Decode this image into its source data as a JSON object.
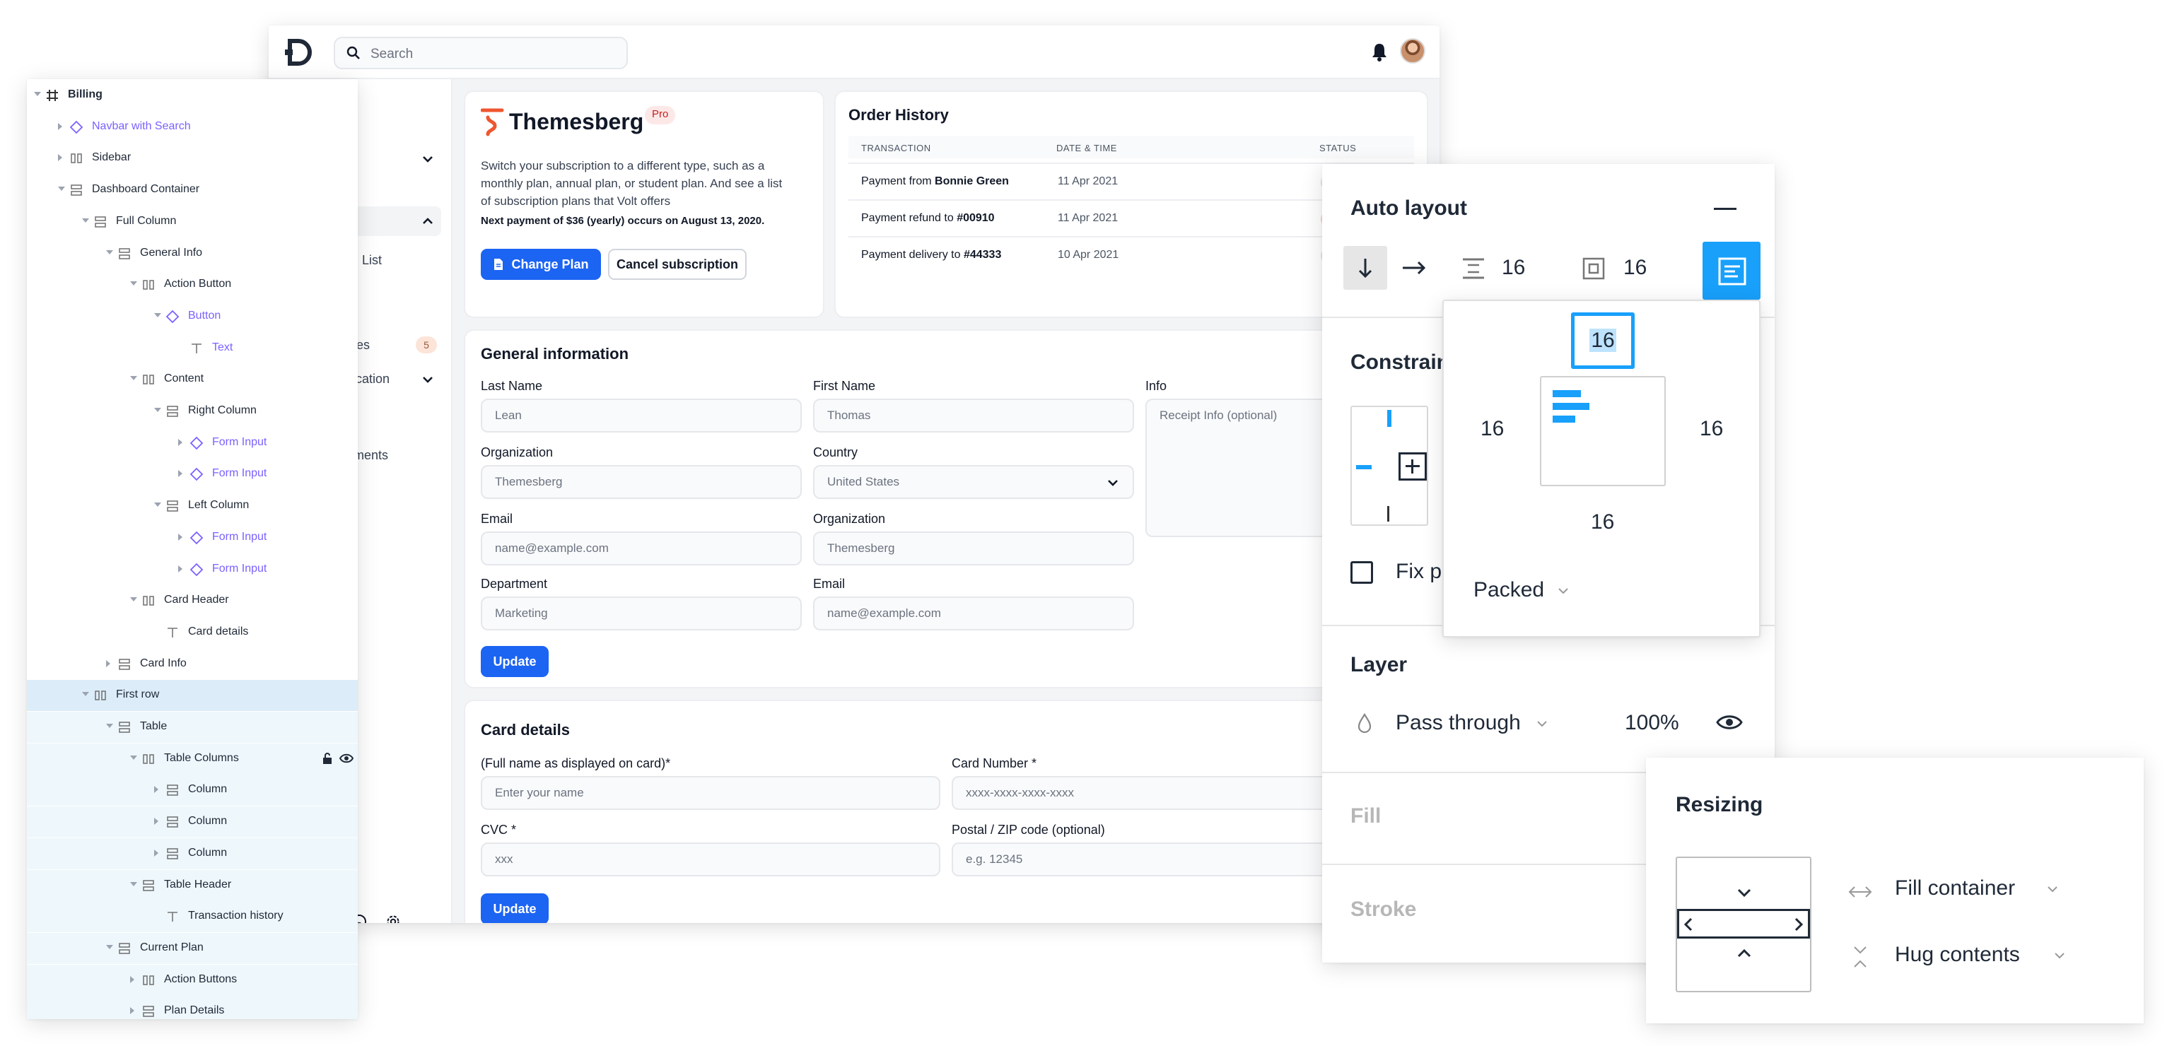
{
  "app": {
    "search_placeholder": "Search",
    "sidebar": {
      "fragments": [
        "w",
        "List",
        "es",
        "tication",
        "ments"
      ],
      "badge": "5"
    },
    "plan": {
      "brand": "Themesberg",
      "badge": "Pro",
      "desc_lines": [
        "Switch your subscription to a different type, such as a",
        "monthly plan, annual plan, or student plan. And see a list",
        "of subscription plans that Volt offers"
      ],
      "next_payment": "Next payment of $36 (yearly) occurs on August 13, 2020.",
      "change_plan": "Change Plan",
      "cancel": "Cancel subscription"
    },
    "orders": {
      "title": "Order History",
      "headers": [
        "TRANSACTION",
        "DATE & TIME",
        "STATUS"
      ],
      "rows": [
        {
          "prefix": "Payment from ",
          "bold": "Bonnie Green",
          "date": "11 Apr 2021",
          "status_color": "#e5e7eb"
        },
        {
          "prefix": "Payment refund to ",
          "bold": "#00910",
          "date": "11 Apr 2021",
          "status_color": "#f6d5c8"
        },
        {
          "prefix": "Payment delivery to ",
          "bold": "#44333",
          "date": "10 Apr 2021",
          "status_color": "#e1e4fb"
        }
      ]
    },
    "general": {
      "title": "General information",
      "last_name_label": "Last Name",
      "last_name": "Lean",
      "first_name_label": "First Name",
      "first_name": "Thomas",
      "info_label": "Info",
      "info_placeholder": "Receipt Info (optional)",
      "org_label": "Organization",
      "org": "Themesberg",
      "country_label": "Country",
      "country": "United States",
      "email_label": "Email",
      "email": "name@example.com",
      "org2_label": "Organization",
      "org2": "Themesberg",
      "dept_label": "Department",
      "dept": "Marketing",
      "email2_label": "Email",
      "email2": "name@example.com",
      "update": "Update"
    },
    "card_details": {
      "title": "Card details",
      "name_label": "(Full name as displayed on card)*",
      "name_placeholder": "Enter your name",
      "number_label": "Card Number *",
      "number_placeholder": "xxxx-xxxx-xxxx-xxxx",
      "cvc_label": "CVC *",
      "cvc_placeholder": "xxx",
      "zip_label": "Postal / ZIP code (optional)",
      "zip_placeholder": "e.g. 12345",
      "update": "Update"
    }
  },
  "layers": [
    {
      "name": "Billing",
      "depth": 0,
      "icon": "frame-icon",
      "arrow": "down",
      "style": "bold"
    },
    {
      "name": "Navbar with Search",
      "depth": 1,
      "icon": "component-icon",
      "arrow": "right",
      "style": "purple"
    },
    {
      "name": "Sidebar",
      "depth": 1,
      "icon": "columns-icon",
      "arrow": "right"
    },
    {
      "name": "Dashboard Container",
      "depth": 1,
      "icon": "rows-icon",
      "arrow": "down"
    },
    {
      "name": "Full Column",
      "depth": 2,
      "icon": "rows-icon",
      "arrow": "down"
    },
    {
      "name": "General Info",
      "depth": 3,
      "icon": "rows-icon",
      "arrow": "down"
    },
    {
      "name": "Action Button",
      "depth": 4,
      "icon": "columns-icon",
      "arrow": "down"
    },
    {
      "name": "Button",
      "depth": 5,
      "icon": "component-icon",
      "arrow": "down",
      "style": "purple"
    },
    {
      "name": "Text",
      "depth": 6,
      "icon": "text-icon",
      "arrow": "none",
      "style": "purple"
    },
    {
      "name": "Content",
      "depth": 4,
      "icon": "columns-icon",
      "arrow": "down"
    },
    {
      "name": "Right Column",
      "depth": 5,
      "icon": "rows-icon",
      "arrow": "down"
    },
    {
      "name": "Form Input",
      "depth": 6,
      "icon": "component-icon",
      "arrow": "right",
      "style": "purple"
    },
    {
      "name": "Form Input",
      "depth": 6,
      "icon": "component-icon",
      "arrow": "right",
      "style": "purple"
    },
    {
      "name": "Left Column",
      "depth": 5,
      "icon": "rows-icon",
      "arrow": "down"
    },
    {
      "name": "Form Input",
      "depth": 6,
      "icon": "component-icon",
      "arrow": "right",
      "style": "purple"
    },
    {
      "name": "Form Input",
      "depth": 6,
      "icon": "component-icon",
      "arrow": "right",
      "style": "purple"
    },
    {
      "name": "Card Header",
      "depth": 4,
      "icon": "columns-icon",
      "arrow": "down"
    },
    {
      "name": "Card details",
      "depth": 5,
      "icon": "text-icon",
      "arrow": "none"
    },
    {
      "name": "Card Info",
      "depth": 3,
      "icon": "rows-icon",
      "arrow": "right"
    },
    {
      "name": "First row",
      "depth": 2,
      "icon": "columns-icon",
      "arrow": "down",
      "state": "selected"
    },
    {
      "name": "Table",
      "depth": 3,
      "icon": "rows-icon",
      "arrow": "down",
      "state": "child"
    },
    {
      "name": "Table Columns",
      "depth": 4,
      "icon": "columns-icon",
      "arrow": "down",
      "state": "child",
      "trailing": true
    },
    {
      "name": "Column",
      "depth": 5,
      "icon": "rows-icon",
      "arrow": "right",
      "state": "child"
    },
    {
      "name": "Column",
      "depth": 5,
      "icon": "rows-icon",
      "arrow": "right",
      "state": "child"
    },
    {
      "name": "Column",
      "depth": 5,
      "icon": "rows-icon",
      "arrow": "right",
      "state": "child"
    },
    {
      "name": "Table Header",
      "depth": 4,
      "icon": "rows-icon",
      "arrow": "down",
      "state": "child"
    },
    {
      "name": "Transaction history",
      "depth": 5,
      "icon": "text-icon",
      "arrow": "none",
      "state": "child"
    },
    {
      "name": "Current Plan",
      "depth": 3,
      "icon": "rows-icon",
      "arrow": "down",
      "state": "child"
    },
    {
      "name": "Action Buttons",
      "depth": 4,
      "icon": "columns-icon",
      "arrow": "right",
      "state": "child"
    },
    {
      "name": "Plan Details",
      "depth": 4,
      "icon": "rows-icon",
      "arrow": "right",
      "state": "child"
    }
  ],
  "autolayout": {
    "title": "Auto layout",
    "spacing": "16",
    "padding": "16",
    "constraints_fragment": "Constrain",
    "fix_fragment": "Fix p",
    "popover": {
      "top": "16",
      "left": "16",
      "right": "16",
      "bottom": "16",
      "mode": "Packed"
    },
    "layer_title": "Layer",
    "blend": "Pass through",
    "opacity": "100%",
    "fill_title": "Fill",
    "stroke_title": "Stroke",
    "colors": {
      "accent": "#18a0fb",
      "brand_blue": "#1c64f2"
    }
  },
  "resizing": {
    "title": "Resizing",
    "horizontal": "Fill container",
    "vertical": "Hug contents"
  }
}
